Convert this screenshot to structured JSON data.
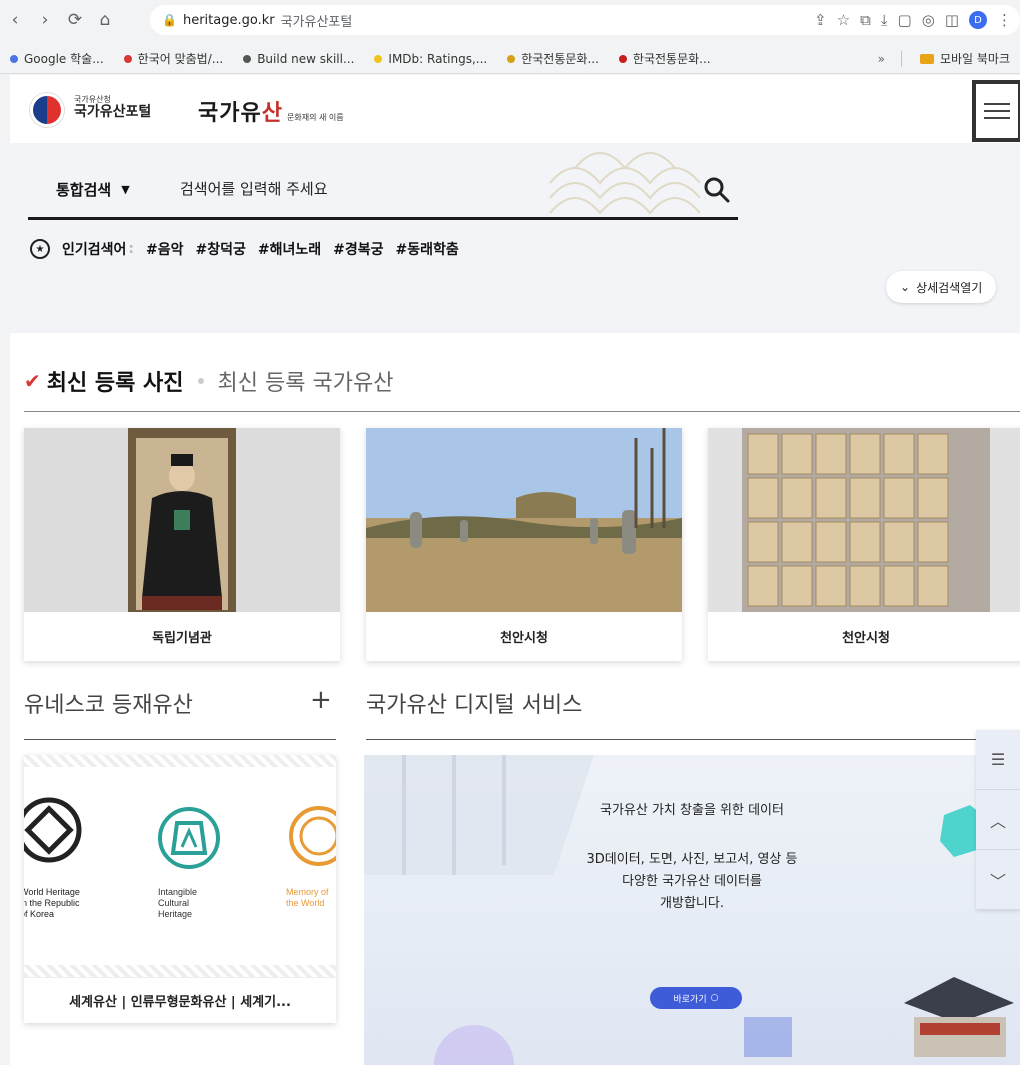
{
  "browser": {
    "url": "heritage.go.kr",
    "page_title": "국가유산포털",
    "profile_initial": "D",
    "bookmarks": [
      {
        "label": "Google 학술...",
        "color": "#4a73e8"
      },
      {
        "label": "한국어 맞춤법/...",
        "color": "#d93636"
      },
      {
        "label": "Build new skill...",
        "color": "#555555"
      },
      {
        "label": "IMDb: Ratings,...",
        "color": "#f0c419"
      },
      {
        "label": "한국전통문화...",
        "color": "#d4a017"
      },
      {
        "label": "한국전통문화...",
        "color": "#c81e1e"
      }
    ],
    "more_label": "»",
    "folder_label": "모바일 북마크"
  },
  "header": {
    "logo_small": "국가유산청",
    "logo_main": "국가유산포털",
    "brand_main_a": "국가유",
    "brand_main_b": "산",
    "brand_sub": "문화재의 새 이름"
  },
  "search": {
    "type_label": "통합검색",
    "placeholder": "검색어를 입력해 주세요",
    "popular_label": "인기검색어",
    "colon": ":",
    "tags": [
      "#음악",
      "#창덕궁",
      "#해녀노래",
      "#경복궁",
      "#동래학춤"
    ],
    "detail_label": "상세검색열기"
  },
  "photos": {
    "tab_active": "최신 등록 사진",
    "tab_inactive": "최신 등록 국가유산",
    "cards": [
      {
        "caption": "독립기념관"
      },
      {
        "caption": "천안시청"
      },
      {
        "caption": "천안시청"
      }
    ]
  },
  "unesco": {
    "title": "유네스코 등재유산",
    "plus": "+",
    "emblem1": [
      "World Heritage",
      "in the Republic",
      "of Korea"
    ],
    "emblem2": [
      "Intangible",
      "Cultural",
      "Heritage"
    ],
    "emblem3": [
      "Memory of",
      "the World"
    ],
    "caption": "세계유산 | 인류무형문화유산 | 세계기..."
  },
  "digital": {
    "title": "국가유산 디지털 서비스",
    "headline": "국가유산 가치 창출을 위한 데이터",
    "body_lines": [
      "3D데이터, 도면, 사진, 보고서, 영상 등",
      "다양한 국가유산 데이터를",
      "개방합니다."
    ],
    "go_label": "바로가기"
  }
}
